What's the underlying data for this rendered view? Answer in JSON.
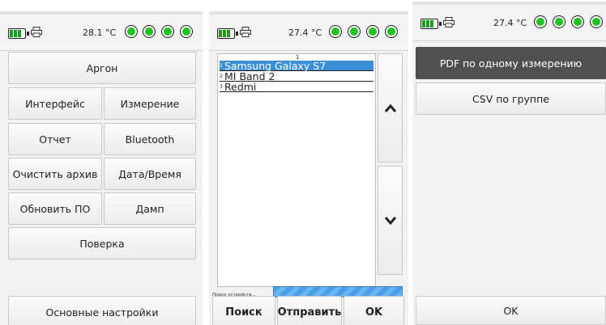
{
  "colors": {
    "led": "#22c222",
    "battery": "#1e9a1e",
    "selection": "#3a8fd6",
    "progress": "#4a9ee8",
    "dark_button": "#505050"
  },
  "icons": {
    "battery": "battery-icon",
    "printer": "printer-icon",
    "led": "status-led-icon",
    "chevron_up": "chevron-up-icon",
    "chevron_down": "chevron-down-icon"
  },
  "panel1": {
    "temperature": "28.1 °C",
    "buttons": {
      "argon": "Аргон",
      "interface": "Интерфейс",
      "measurement": "Измерение",
      "report": "Отчет",
      "bluetooth": "Bluetooth",
      "clear_archive": "Очистить архив",
      "datetime": "Дата/Время",
      "update_fw": "Обновить ПО",
      "dump": "Дамп",
      "verification": "Поверка",
      "main_settings": "Основные настройки"
    }
  },
  "panel2": {
    "temperature": "27.4 °C",
    "list_header": "1",
    "devices": [
      {
        "index": "1",
        "name": "Samsung Galaxy S7"
      },
      {
        "index": "2",
        "name": "MI Band 2"
      },
      {
        "index": "3",
        "name": "Redmi"
      }
    ],
    "progress_label": "Поиск устройств...",
    "progress": 1.0,
    "buttons": {
      "search": "Поиск",
      "send": "Отправить",
      "ok": "OK"
    }
  },
  "panel3": {
    "temperature": "27.4 °C",
    "buttons": {
      "pdf_single": "PDF по одному измерению",
      "csv_group": "CSV по группе",
      "ok": "OK"
    }
  }
}
